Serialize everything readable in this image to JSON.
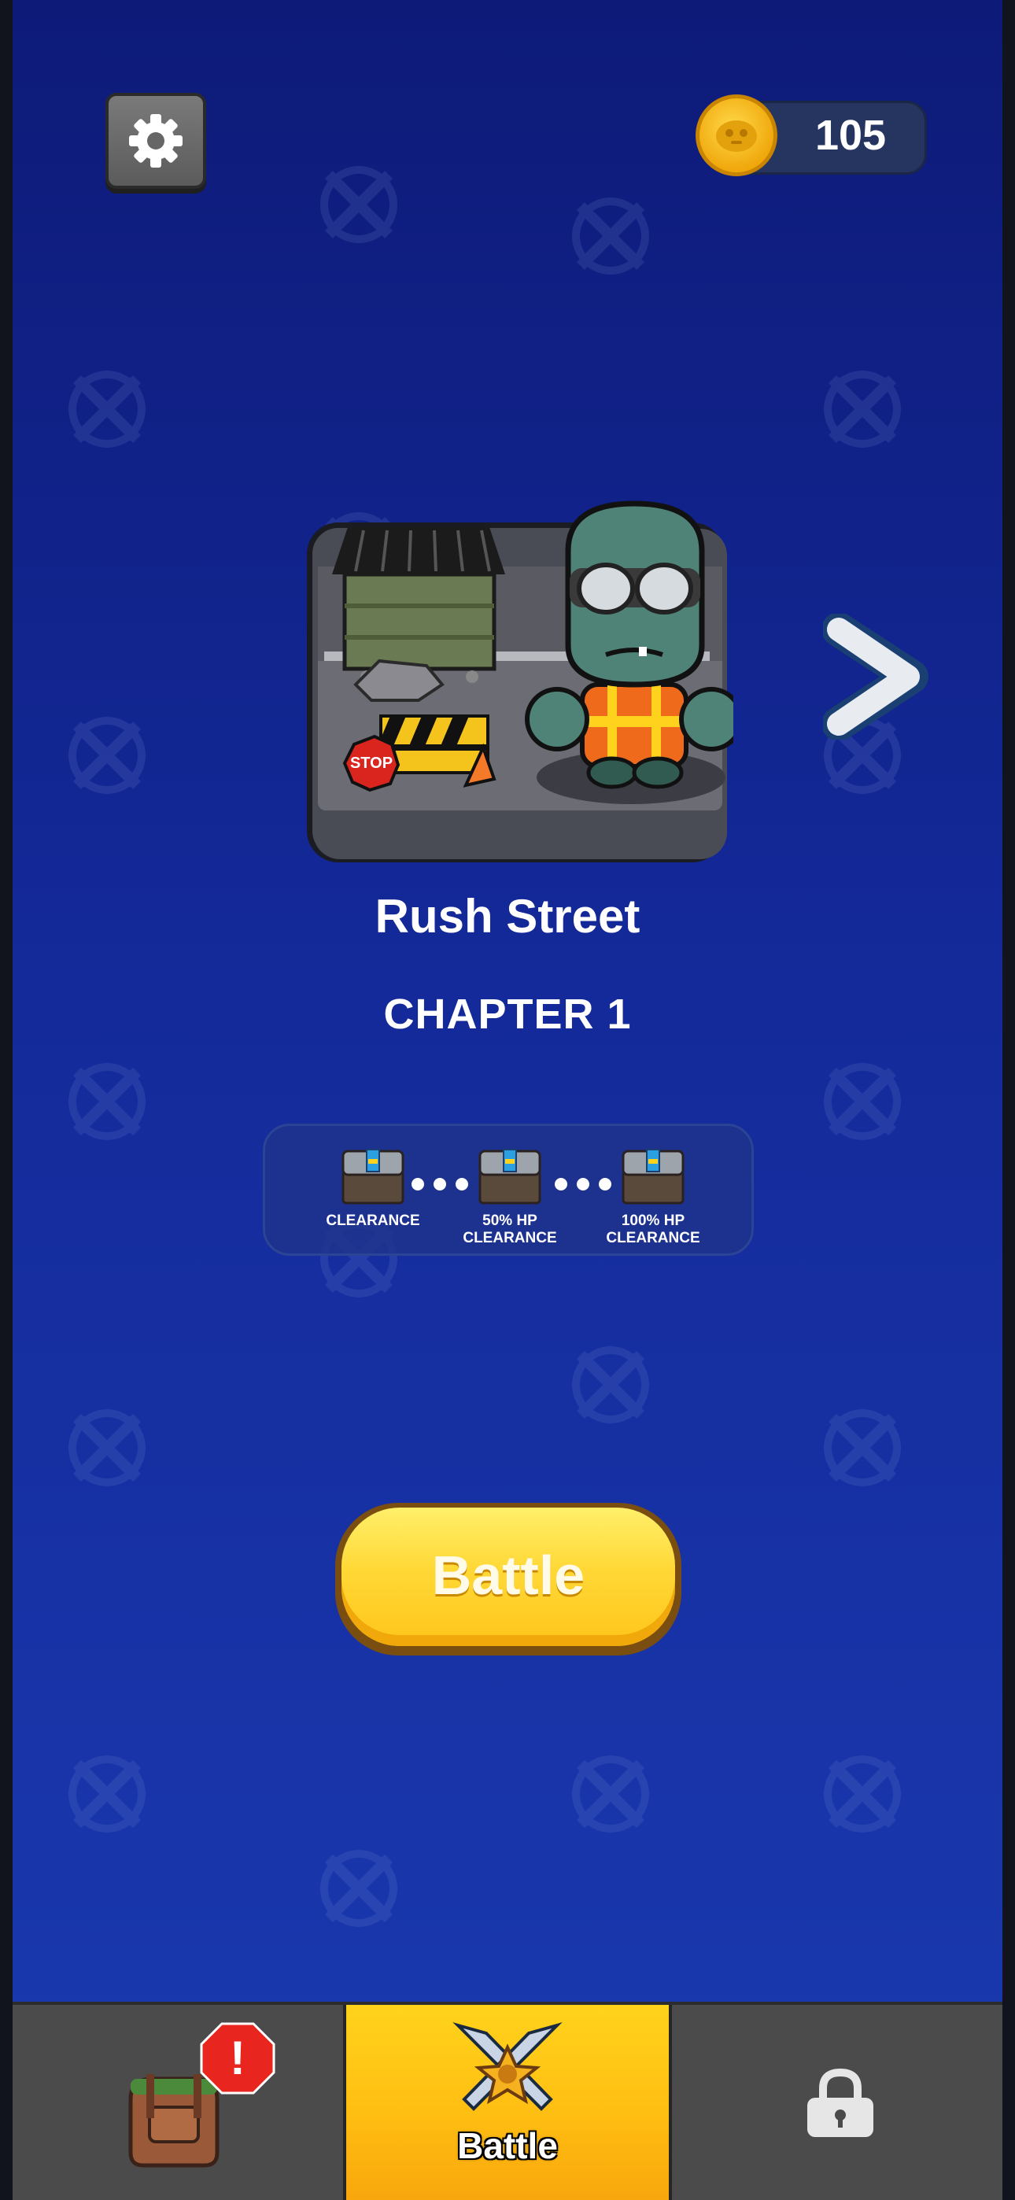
{
  "coins": {
    "value": "105"
  },
  "stage": {
    "title": "Rush Street",
    "chapter": "CHAPTER 1"
  },
  "rewards": [
    {
      "label": "CLEARANCE"
    },
    {
      "label": "50% HP\nCLEARANCE"
    },
    {
      "label": "100% HP\nCLEARANCE"
    }
  ],
  "battle_button": {
    "label": "Battle"
  },
  "bottom_nav": {
    "tabs": [
      {
        "name": "inventory",
        "icon": "backpack-icon",
        "alert": "!"
      },
      {
        "name": "battle",
        "icon": "crossed-swords-icon",
        "label": "Battle"
      },
      {
        "name": "locked",
        "icon": "lock-icon"
      }
    ]
  },
  "colors": {
    "background_top": "#0d1a78",
    "background_bottom": "#1a3ab0",
    "battle_yellow": "#ffd836",
    "nav_gray": "#4a4a4a",
    "alert_red": "#e8261f"
  }
}
